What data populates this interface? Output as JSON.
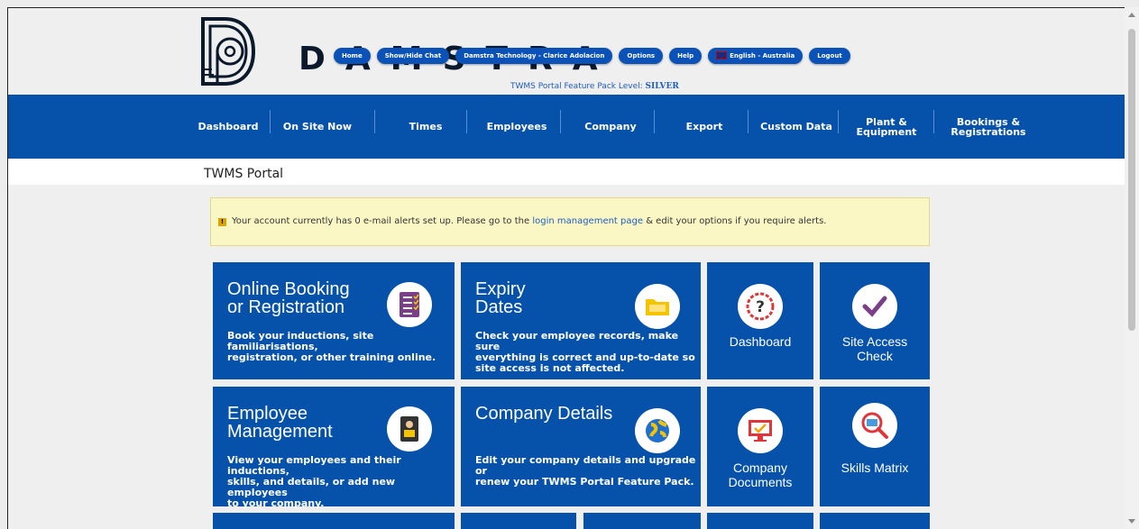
{
  "brand": {
    "logo_text": "DAMSTRA"
  },
  "header_buttons": [
    {
      "label": "Home"
    },
    {
      "label": "Show/Hide Chat"
    },
    {
      "label": "Damstra Technology - Clarice Adolacion"
    },
    {
      "label": "Options"
    },
    {
      "label": "Help"
    },
    {
      "label": "English - Australia"
    },
    {
      "label": "Logout"
    }
  ],
  "feature_pack": {
    "prefix": "TWMS Portal Feature Pack Level: ",
    "level": "SILVER"
  },
  "nav": {
    "dashboard": "Dashboard",
    "on_site_now": "On Site Now",
    "times": "Times",
    "employees": "Employees",
    "company": "Company",
    "export": "Export",
    "custom_data": "Custom Data",
    "plant_line1": "Plant &",
    "plant_line2": "Equipment",
    "bookings_line1": "Bookings &",
    "bookings_line2": "Registrations"
  },
  "portal_title": "TWMS Portal",
  "alert": {
    "before": "Your account currently has 0 e-mail alerts set up. Please go to the ",
    "link": "login management page",
    "after": " & edit your options if you require alerts."
  },
  "tiles": {
    "online_booking": {
      "title_line1": "Online Booking",
      "title_line2": "or Registration",
      "desc_line1": "Book your inductions, site familiarisations,",
      "desc_line2": "registration, or other training online."
    },
    "expiry": {
      "title_line1": "Expiry",
      "title_line2": "Dates",
      "desc_line1": "Check your employee records, make sure",
      "desc_line2": "everything is correct and up-to-date so",
      "desc_line3": "site access is not affected."
    },
    "dashboard": {
      "label": "Dashboard"
    },
    "site_access": {
      "line1": "Site Access",
      "line2": "Check"
    },
    "employee_mgmt": {
      "title_line1": "Employee",
      "title_line2": "Management",
      "desc_line1": "View your employees and their inductions,",
      "desc_line2": "skills, and details, or add new employees",
      "desc_line3": "to your company."
    },
    "company_details": {
      "title": "Company Details",
      "desc_line1": "Edit your company details and upgrade or",
      "desc_line2": "renew your TWMS Portal Feature Pack."
    },
    "company_docs": {
      "line1": "Company",
      "line2": "Documents"
    },
    "skills_matrix": {
      "label": "Skills Matrix"
    }
  },
  "colors": {
    "primary_blue": "#0652ab",
    "alert_bg": "#fbf7c5",
    "link": "#1e5ebf"
  }
}
